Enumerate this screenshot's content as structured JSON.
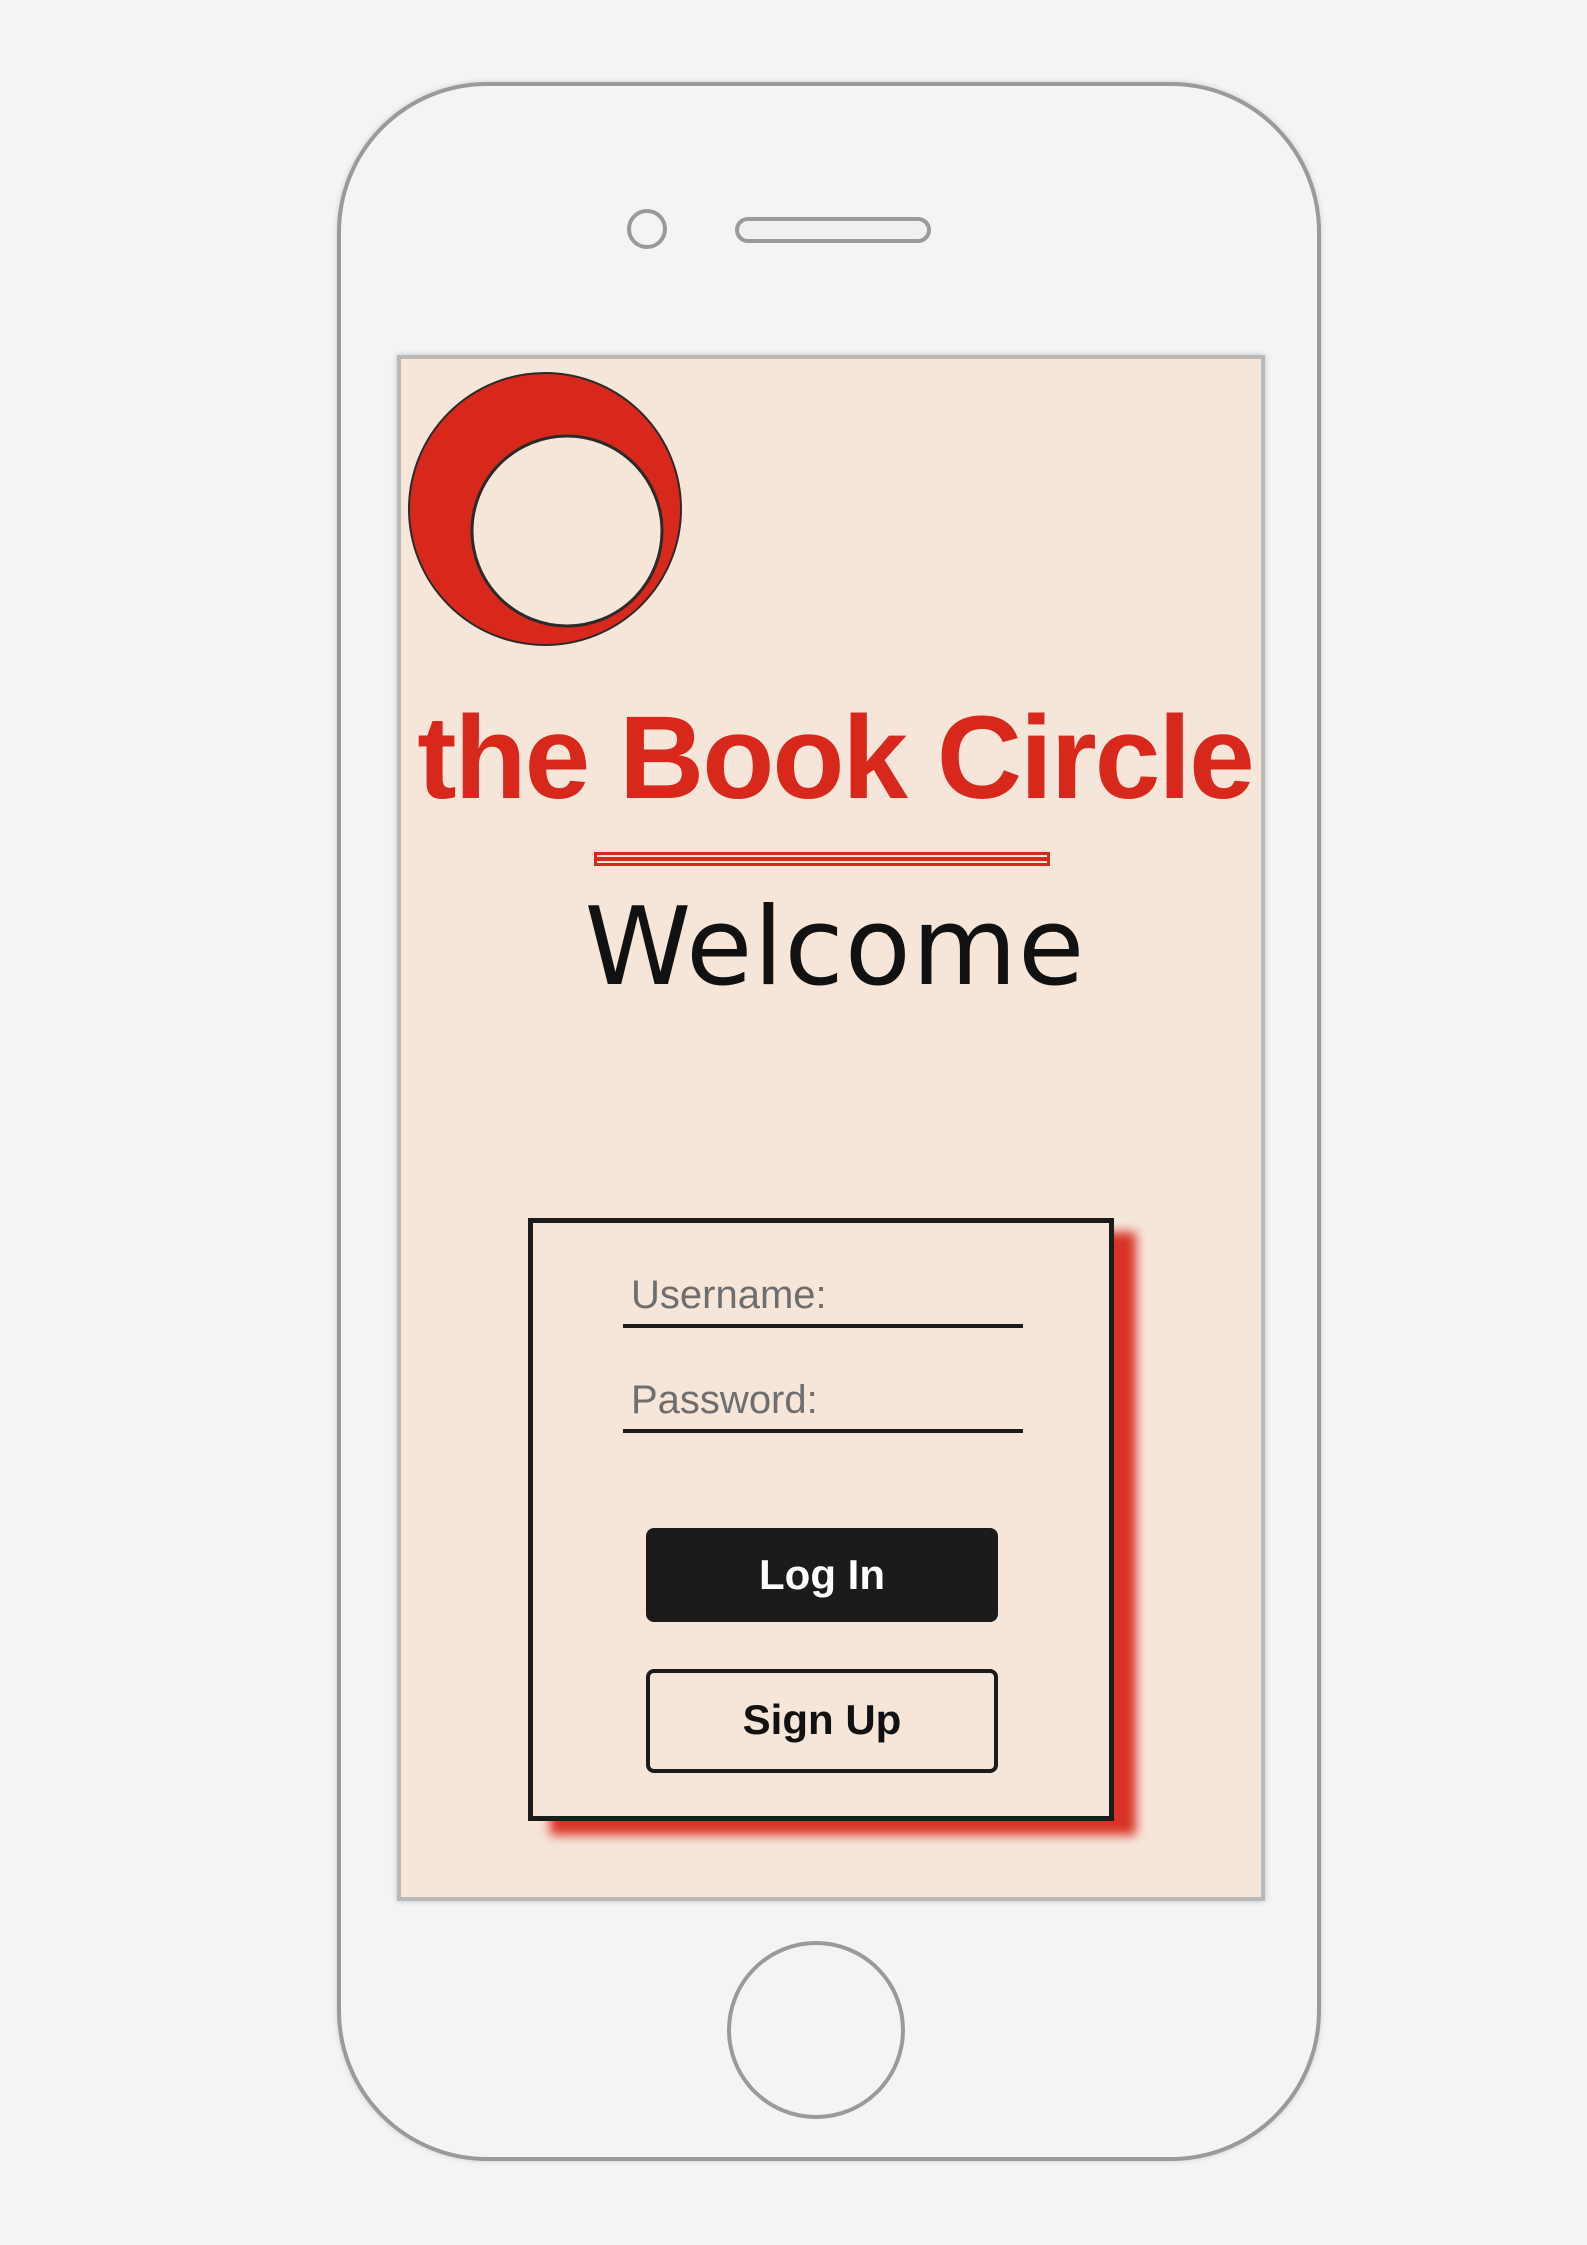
{
  "app": {
    "brand_name": "the Book Circle",
    "welcome_text": "Welcome"
  },
  "login_form": {
    "username_placeholder": "Username:",
    "password_placeholder": "Password:",
    "login_label": "Log In",
    "signup_label": "Sign Up"
  },
  "colors": {
    "brand_red": "#d8281c",
    "screen_background": "#f6e6da",
    "button_dark": "#1b1b1b"
  },
  "icons": {
    "logo": "circle-logo-icon"
  }
}
